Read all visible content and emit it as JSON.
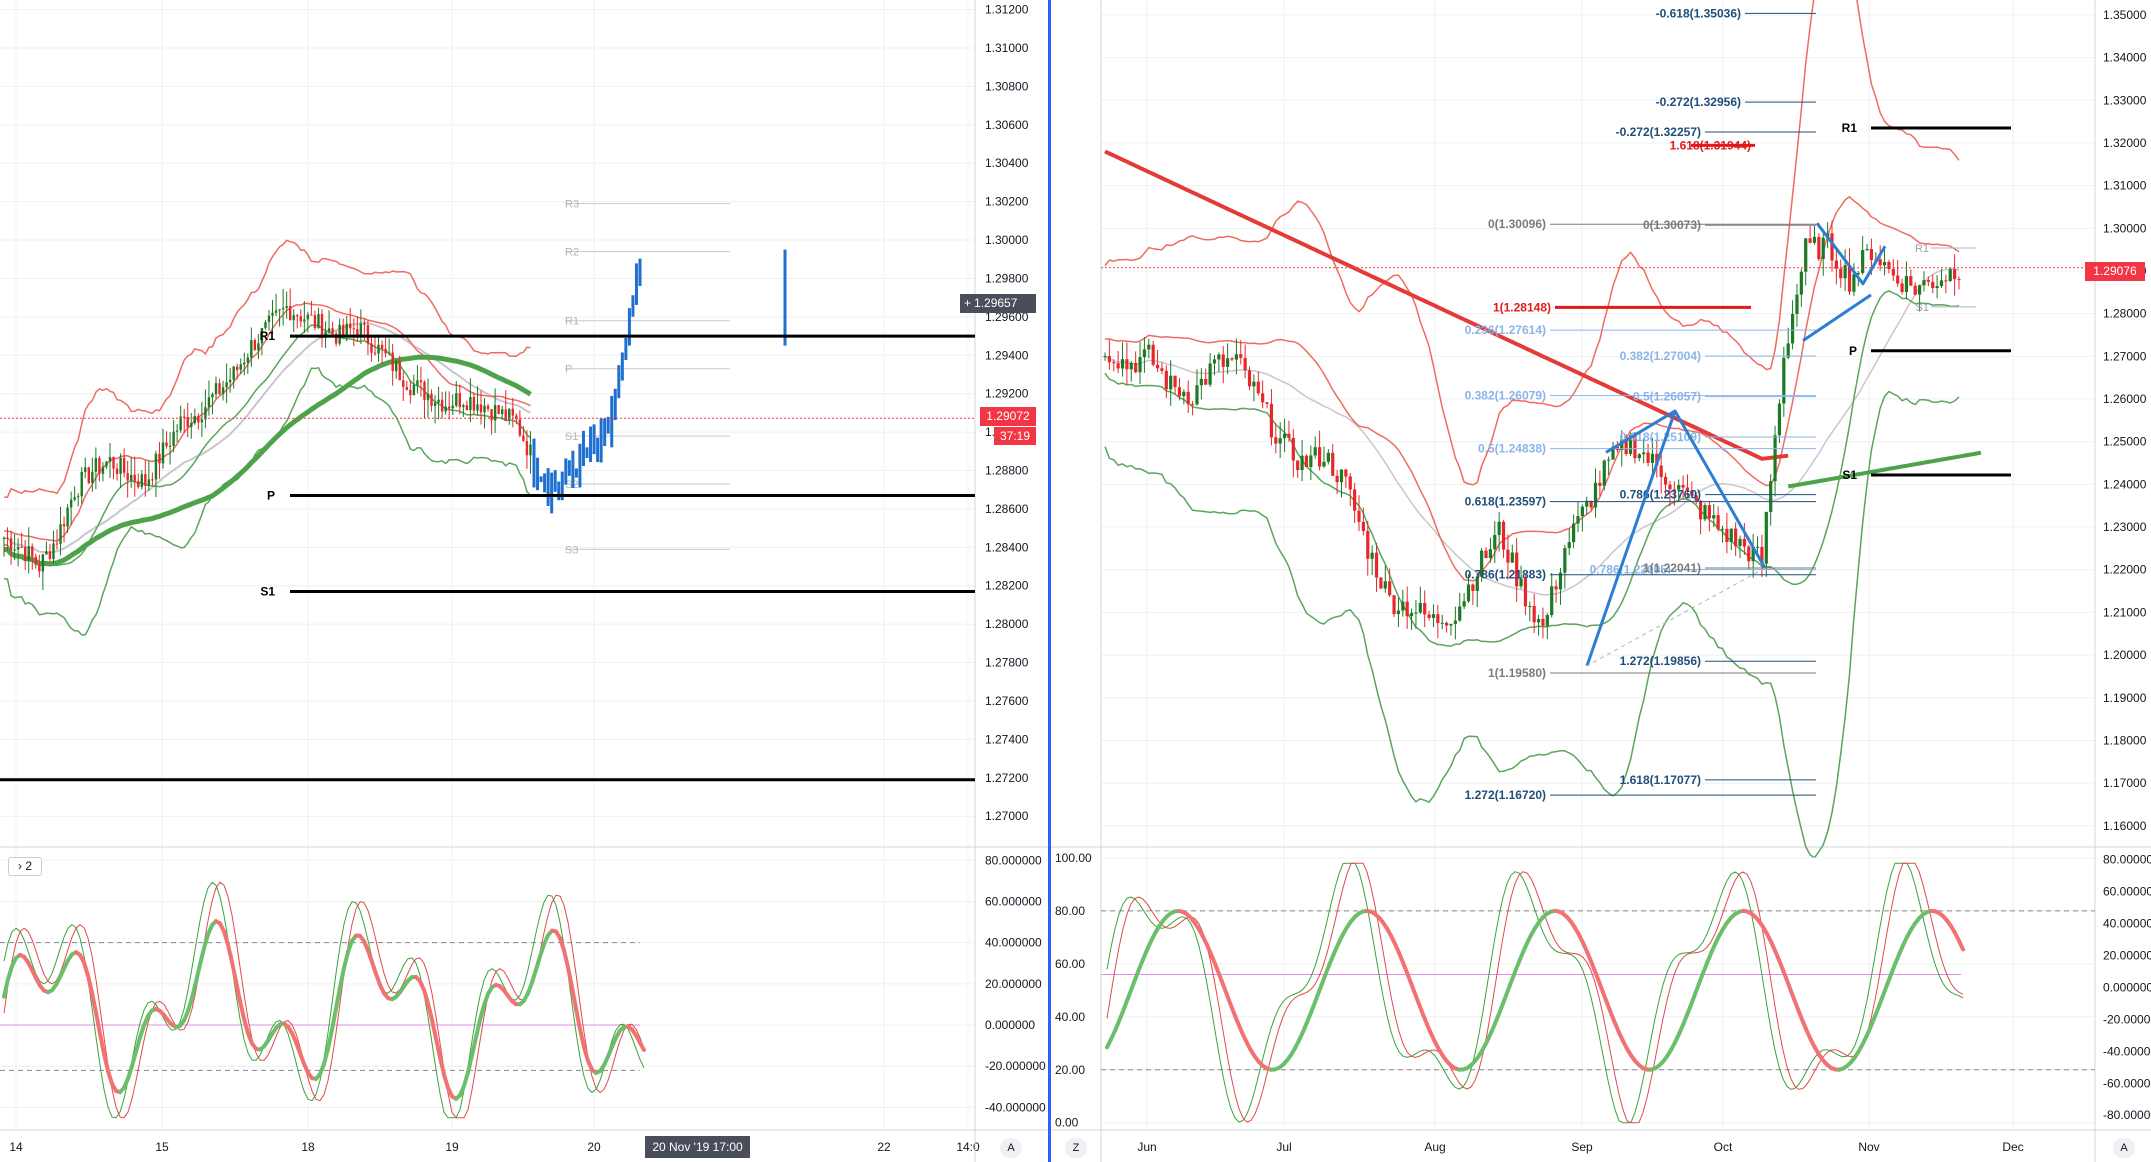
{
  "colors": {
    "up": "#1b7a23",
    "down": "#e8262b",
    "bar_blue": "#1e6fd0",
    "band_red": "#ef6b62",
    "band_green": "#5aa55b",
    "ma_green": "#4ea34a",
    "ma_red": "#e33b37",
    "ma_grey": "#c9c6cb",
    "price_red": "#f23645",
    "fib_blue": "#1f4e79",
    "fib_light": "#8ab4e8",
    "fib_grey": "#7a7a7a",
    "pattern_blue": "#2d7dd2",
    "stoch_green": "#6cbf6a",
    "stoch_red": "#f07272",
    "divider": "#2962ff"
  },
  "left_chart": {
    "type": "candlestick",
    "price_axis": [
      "1.31200",
      "1.31000",
      "1.30800",
      "1.30600",
      "1.30400",
      "1.30200",
      "1.30000",
      "1.29800",
      "1.29600",
      "1.29400",
      "1.29200",
      "1.29000",
      "1.28800",
      "1.28600",
      "1.28400",
      "1.28200",
      "1.28000",
      "1.27800",
      "1.27600",
      "1.27400",
      "1.27200",
      "1.27000"
    ],
    "ylim": [
      1.2685,
      1.3125
    ],
    "time_axis": [
      "14",
      "15",
      "18",
      "19",
      "20",
      "20 Nov '19  17:00",
      "22",
      "14:0"
    ],
    "crosshair_price": "1.29657",
    "last_price": "1.29072",
    "countdown": "37:19",
    "pivots": [
      {
        "label": "R1",
        "value": 1.295
      },
      {
        "label": "P",
        "value": 1.2867
      },
      {
        "label": "S1",
        "value": 1.2817
      },
      {
        "label": "",
        "value": 1.2719
      }
    ],
    "faint_pivots": [
      {
        "label": "R3",
        "value": 1.3019
      },
      {
        "label": "R2",
        "value": 1.2994
      },
      {
        "label": "R1",
        "value": 1.2958
      },
      {
        "label": "P",
        "value": 1.2933
      },
      {
        "label": "S1",
        "value": 1.2898
      },
      {
        "label": "S2",
        "value": 1.2873
      },
      {
        "label": "S3",
        "value": 1.2839
      }
    ],
    "indicator_label": "2",
    "stoch_axis": [
      "80.000000",
      "60.000000",
      "40.000000",
      "20.000000",
      "0.000000",
      "-20.000000",
      "-40.000000"
    ],
    "stoch_ylim": [
      -50,
      85
    ],
    "stoch_levels": [
      40,
      -22,
      0
    ],
    "axis_button": "A"
  },
  "right_chart": {
    "type": "candlestick",
    "price_axis": [
      "1.35000",
      "1.34000",
      "1.33000",
      "1.32000",
      "1.31000",
      "1.30000",
      "1.29000",
      "1.28000",
      "1.27000",
      "1.26000",
      "1.25000",
      "1.24000",
      "1.23000",
      "1.22000",
      "1.21000",
      "1.20000",
      "1.19000",
      "1.18000",
      "1.17000",
      "1.16000"
    ],
    "ylim": [
      1.1555,
      1.3535
    ],
    "time_axis": [
      "Jun",
      "Jul",
      "Aug",
      "Sep",
      "Oct",
      "Nov",
      "Dec"
    ],
    "last_price": "1.29076",
    "pivots": [
      {
        "label": "R1",
        "value": 1.3235
      },
      {
        "label": "P",
        "value": 1.2713
      },
      {
        "label": "S1",
        "value": 1.2422
      }
    ],
    "fib_labels": [
      {
        "text": "-0.618(1.35036)",
        "value": 1.35036,
        "tone": "dark"
      },
      {
        "text": "-0.272(1.32956)",
        "value": 1.32956,
        "tone": "dark"
      },
      {
        "text": "-0.272(1.32257)",
        "value": 1.32257,
        "tone": "dark"
      },
      {
        "text": "1.618(1.31944)",
        "value": 1.31944,
        "tone": "red"
      },
      {
        "text": "0(1.30096)",
        "value": 1.30096,
        "tone": "grey"
      },
      {
        "text": "0(1.30073)",
        "value": 1.30073,
        "tone": "grey"
      },
      {
        "text": "1(1.28148)",
        "value": 1.28148,
        "tone": "red"
      },
      {
        "text": "0.236(1.27614)",
        "value": 1.27614,
        "tone": "light"
      },
      {
        "text": "0.382(1.27004)",
        "value": 1.27004,
        "tone": "light"
      },
      {
        "text": "0.382(1.26079)",
        "value": 1.26079,
        "tone": "light"
      },
      {
        "text": "0.5(1.26057)",
        "value": 1.26057,
        "tone": "light"
      },
      {
        "text": "0.618(1.25109)",
        "value": 1.25109,
        "tone": "light"
      },
      {
        "text": "0.5(1.24838)",
        "value": 1.24838,
        "tone": "light"
      },
      {
        "text": "0.786(1.23760)",
        "value": 1.2376,
        "tone": "dark"
      },
      {
        "text": "0.618(1.23597)",
        "value": 1.23597,
        "tone": "dark"
      },
      {
        "text": "0.786(1.21883)",
        "value": 1.21883,
        "tone": "dark"
      },
      {
        "text": "0.786(1.22005)",
        "value": 1.22005,
        "tone": "light"
      },
      {
        "text": "1(1.22041)",
        "value": 1.22041,
        "tone": "grey"
      },
      {
        "text": "1.272(1.19856)",
        "value": 1.19856,
        "tone": "dark"
      },
      {
        "text": "1(1.19580)",
        "value": 1.1958,
        "tone": "grey"
      },
      {
        "text": "1.618(1.17077)",
        "value": 1.17077,
        "tone": "dark"
      },
      {
        "text": "1.272(1.16720)",
        "value": 1.1672,
        "tone": "dark"
      }
    ],
    "faint_pivots": [
      {
        "label": "R1",
        "value": 1.2954
      },
      {
        "label": "S1",
        "value": 1.2816
      }
    ],
    "stoch_left_axis": [
      "100.00",
      "80.00",
      "60.00",
      "40.00",
      "20.00",
      "0.00"
    ],
    "stoch_right_axis": [
      "80.000000",
      "60.000000",
      "40.000000",
      "20.000000",
      "0.000000",
      "-20.000000",
      "-40.000000",
      "-60.000000",
      "-80.000000"
    ],
    "stoch_ylim": [
      -2,
      103
    ],
    "stoch_levels": [
      80,
      20,
      56
    ],
    "z_button": "Z",
    "axis_button": "A"
  },
  "chart_data": [
    {
      "type": "candlestick",
      "title": "",
      "x": [
        "14",
        "15",
        "18",
        "19",
        "20",
        "21",
        "22"
      ],
      "ylim": [
        1.2685,
        1.3125
      ],
      "close_path": [
        [
          0,
          1.2845
        ],
        [
          5,
          1.284
        ],
        [
          10,
          1.283
        ],
        [
          15,
          1.2845
        ],
        [
          20,
          1.287
        ],
        [
          25,
          1.288
        ],
        [
          30,
          1.2885
        ],
        [
          35,
          1.2878
        ],
        [
          40,
          1.2874
        ],
        [
          45,
          1.289
        ],
        [
          50,
          1.2905
        ],
        [
          55,
          1.291
        ],
        [
          60,
          1.292
        ],
        [
          65,
          1.293
        ],
        [
          70,
          1.2945
        ],
        [
          75,
          1.2955
        ],
        [
          80,
          1.2965
        ],
        [
          85,
          1.296
        ],
        [
          90,
          1.2955
        ],
        [
          95,
          1.295
        ],
        [
          100,
          1.2955
        ],
        [
          105,
          1.2945
        ],
        [
          110,
          1.2935
        ],
        [
          115,
          1.2925
        ],
        [
          120,
          1.292
        ],
        [
          125,
          1.2915
        ],
        [
          130,
          1.2918
        ],
        [
          135,
          1.2915
        ],
        [
          140,
          1.291
        ],
        [
          145,
          1.2905
        ],
        [
          150,
          1.2885
        ],
        [
          155,
          1.287
        ],
        [
          160,
          1.288
        ],
        [
          165,
          1.289
        ],
        [
          170,
          1.2895
        ],
        [
          175,
          1.2935
        ],
        [
          180,
          1.299
        ]
      ],
      "legend": ""
    },
    {
      "type": "candlestick",
      "title": "",
      "x": [
        "Jun",
        "Jul",
        "Aug",
        "Sep",
        "Oct",
        "Nov",
        "Dec"
      ],
      "ylim": [
        1.1555,
        1.3535
      ],
      "close_path": [
        [
          0,
          1.272
        ],
        [
          5,
          1.268
        ],
        [
          10,
          1.27
        ],
        [
          15,
          1.263
        ],
        [
          20,
          1.261
        ],
        [
          25,
          1.268
        ],
        [
          30,
          1.269
        ],
        [
          35,
          1.26
        ],
        [
          40,
          1.25
        ],
        [
          45,
          1.245
        ],
        [
          50,
          1.247
        ],
        [
          55,
          1.24
        ],
        [
          60,
          1.225
        ],
        [
          65,
          1.213
        ],
        [
          70,
          1.211
        ],
        [
          75,
          1.208
        ],
        [
          80,
          1.21
        ],
        [
          85,
          1.22
        ],
        [
          90,
          1.229
        ],
        [
          95,
          1.216
        ],
        [
          100,
          1.206
        ],
        [
          105,
          1.225
        ],
        [
          110,
          1.235
        ],
        [
          115,
          1.245
        ],
        [
          120,
          1.25
        ],
        [
          125,
          1.245
        ],
        [
          130,
          1.24
        ],
        [
          135,
          1.235
        ],
        [
          140,
          1.23
        ],
        [
          145,
          1.226
        ],
        [
          150,
          1.222
        ],
        [
          155,
          1.27
        ],
        [
          160,
          1.295
        ],
        [
          165,
          1.296
        ],
        [
          170,
          1.288
        ],
        [
          175,
          1.295
        ],
        [
          180,
          1.289
        ],
        [
          185,
          1.286
        ],
        [
          190,
          1.288
        ],
        [
          195,
          1.2908
        ]
      ],
      "legend": ""
    }
  ]
}
